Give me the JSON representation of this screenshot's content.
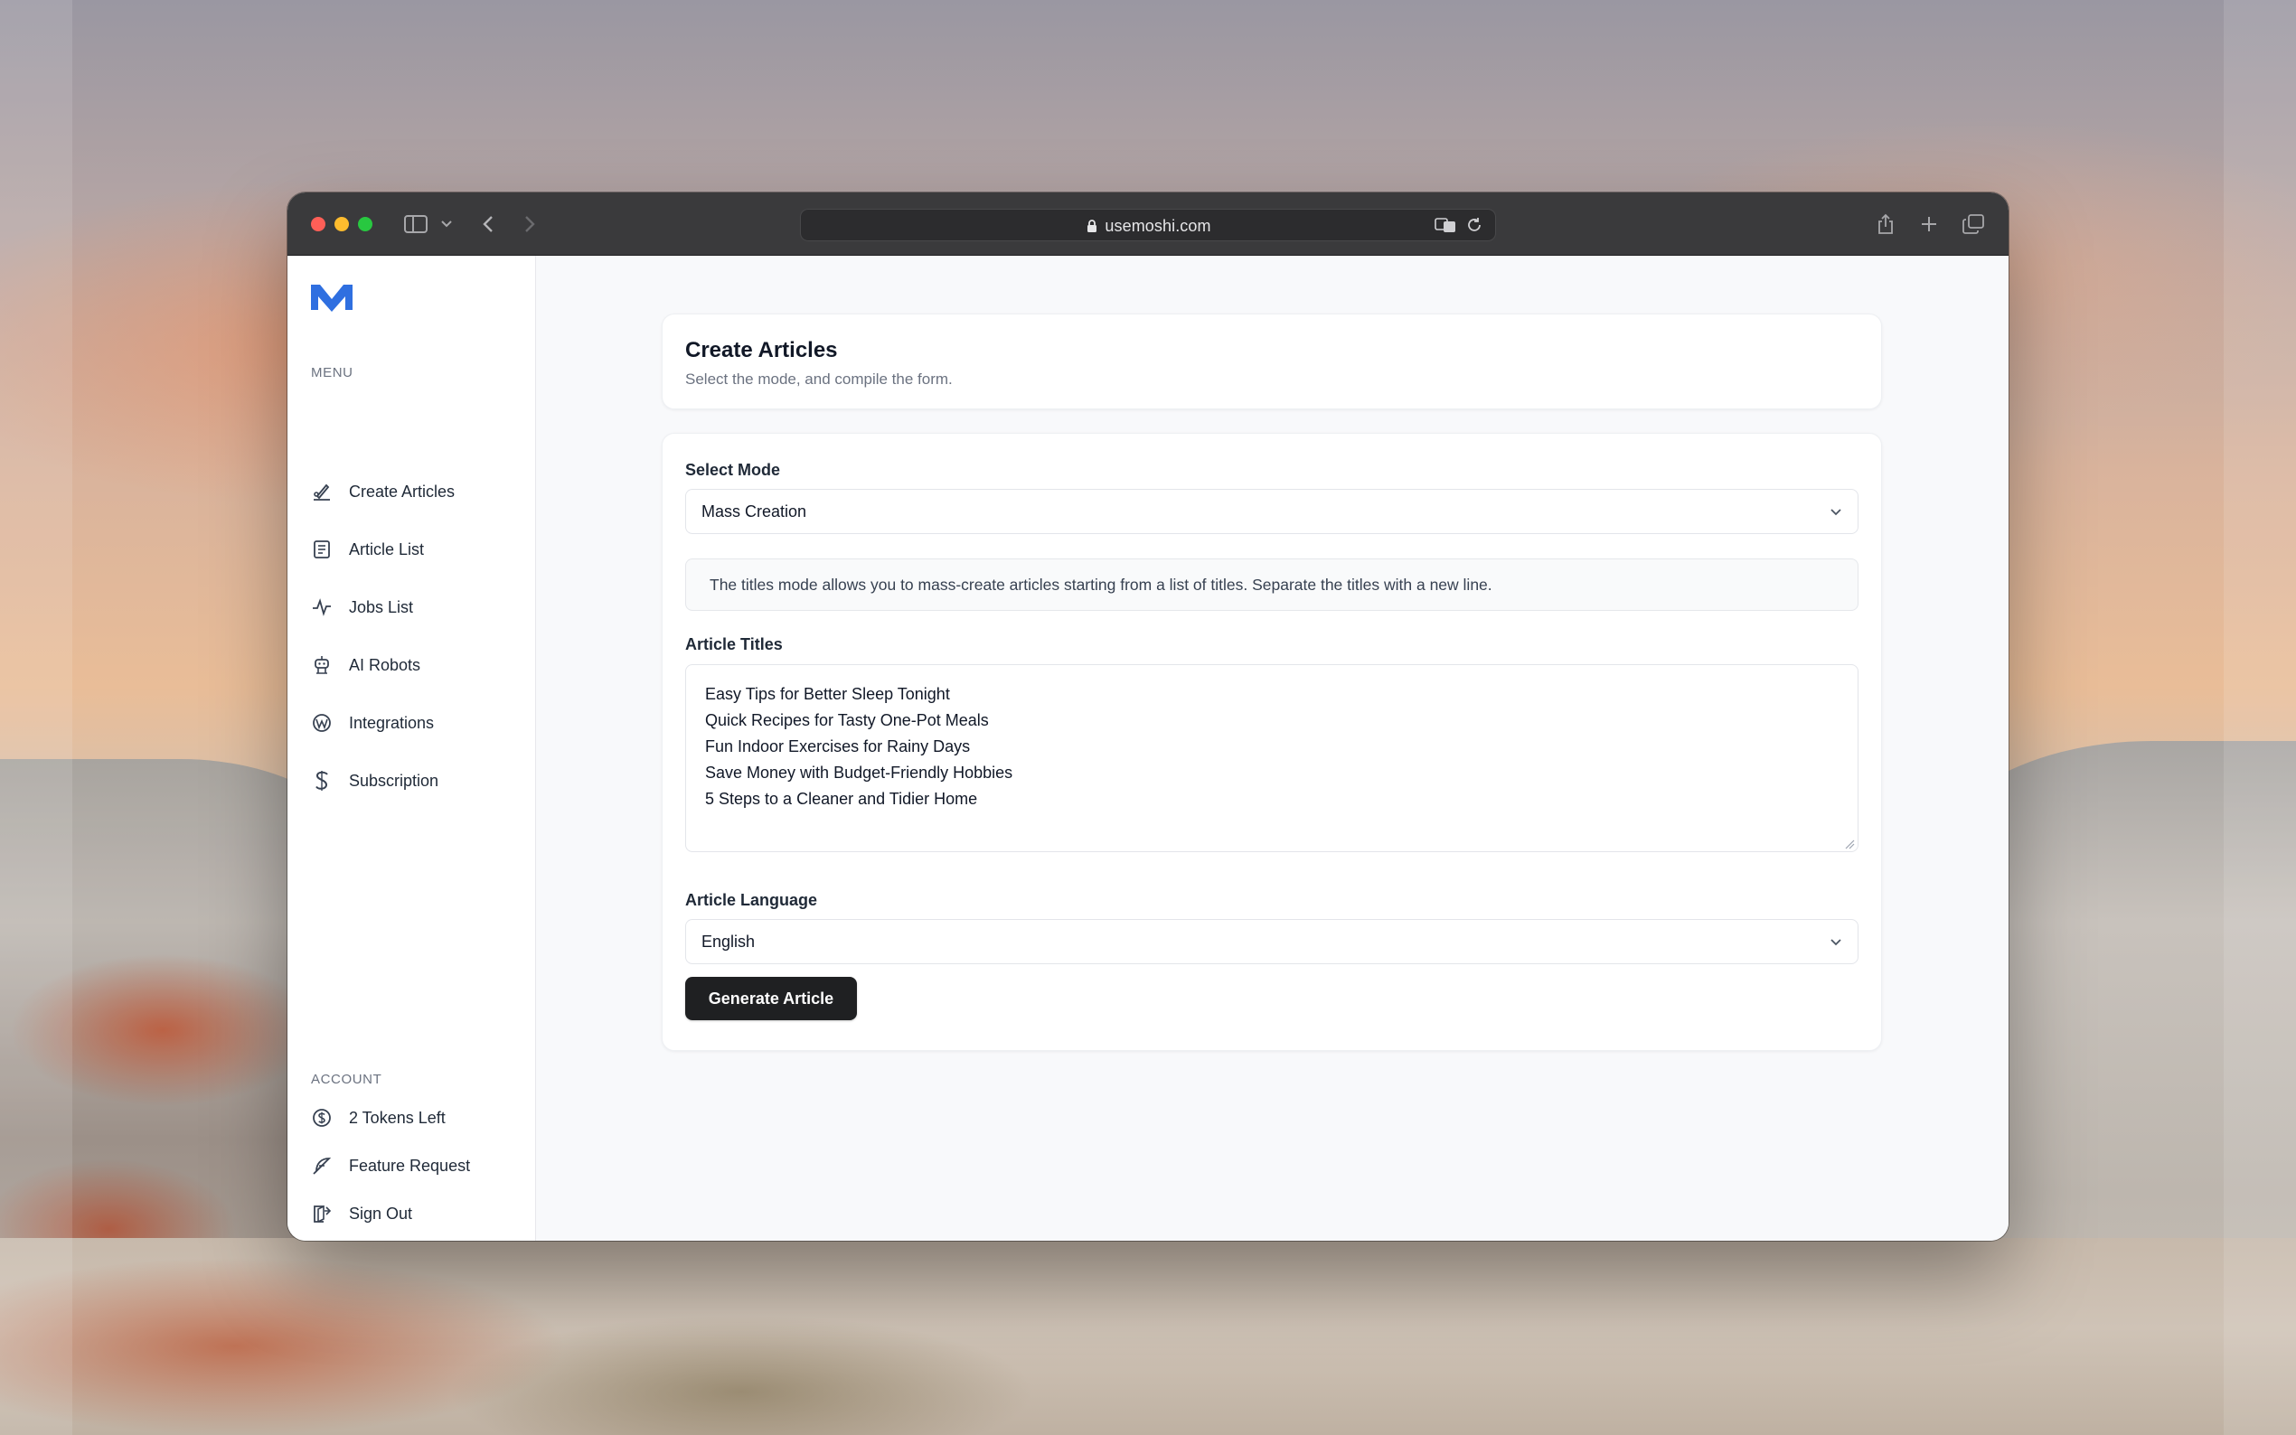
{
  "browser": {
    "url": "usemoshi.com"
  },
  "sidebar": {
    "menu_label": "MENU",
    "menu_items": [
      {
        "label": "Create Articles",
        "icon": "write-icon"
      },
      {
        "label": "Article List",
        "icon": "list-icon"
      },
      {
        "label": "Jobs List",
        "icon": "activity-icon"
      },
      {
        "label": "AI Robots",
        "icon": "robot-icon"
      },
      {
        "label": "Integrations",
        "icon": "wordpress-icon"
      },
      {
        "label": "Subscription",
        "icon": "dollar-s-icon"
      }
    ],
    "account_label": "ACCOUNT",
    "account_items": [
      {
        "label": "2 Tokens Left",
        "icon": "coin-icon"
      },
      {
        "label": "Feature Request",
        "icon": "feather-icon"
      },
      {
        "label": "Sign Out",
        "icon": "exit-door-icon"
      }
    ]
  },
  "header": {
    "title": "Create Articles",
    "subtitle": "Select the mode, and compile the form."
  },
  "form": {
    "mode_label": "Select Mode",
    "mode_value": "Mass Creation",
    "info_text": "The titles mode allows you to mass-create articles starting from a list of titles. Separate the titles with a new line.",
    "titles_label": "Article Titles",
    "titles": [
      "Easy Tips for Better Sleep Tonight",
      "Quick Recipes for Tasty One-Pot Meals",
      "Fun Indoor Exercises for Rainy Days",
      "Save Money with Budget-Friendly Hobbies",
      "5 Steps to a Cleaner and Tidier Home"
    ],
    "language_label": "Article Language",
    "language_value": "English",
    "submit_label": "Generate Article"
  },
  "colors": {
    "accent": "#2f6fe0",
    "button_bg": "#1f2022",
    "titlebar_bg": "#3a3a3c"
  }
}
